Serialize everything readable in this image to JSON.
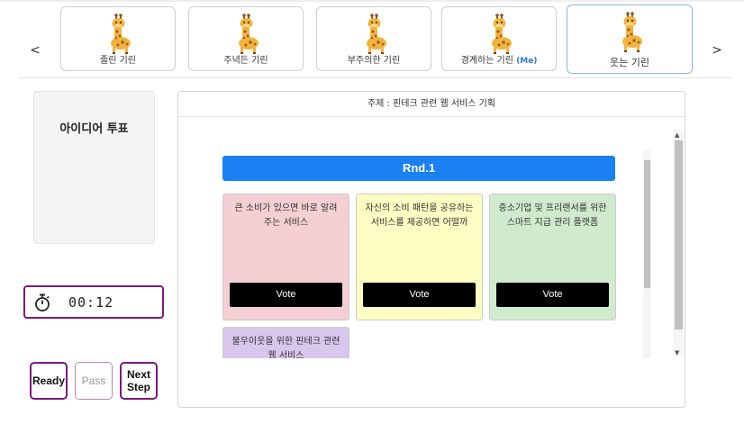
{
  "participants": {
    "prev_arrow": "<",
    "next_arrow": ">",
    "items": [
      {
        "name": "졸린 기린",
        "me_tag": "",
        "active": false
      },
      {
        "name": "주녁든 기린",
        "me_tag": "",
        "active": false
      },
      {
        "name": "부주의한 기린",
        "me_tag": "",
        "active": false
      },
      {
        "name": "경계하는 기린",
        "me_tag": "(Me)",
        "active": false
      },
      {
        "name": "웃는 기린",
        "me_tag": "",
        "active": true
      }
    ]
  },
  "sidebar": {
    "title": "아이디어 투표",
    "timer": "00:12",
    "buttons": {
      "ready": "Ready",
      "pass": "Pass",
      "next_line1": "Next",
      "next_line2": "Step"
    }
  },
  "main": {
    "topic": "주제 : 핀테크 관련 웹 서비스 기획",
    "round": "Rnd.1",
    "vote_label": "Vote",
    "ideas": [
      {
        "text": "큰 소비가 있으면 바로 알려주는 서비스",
        "color": "#f4cfd3"
      },
      {
        "text": "자신의 소비 패턴을 공유하는 서비스를 제공하면 어떨까",
        "color": "#fcfdc3"
      },
      {
        "text": "중소기업 및 프리랜서를 위한 스마트 지급 관리 플랫폼",
        "color": "#cfeacd"
      },
      {
        "text": "불우이웃을 위한 핀테크 관련 웹 서비스",
        "color": "#d9c6ec"
      }
    ]
  },
  "icons": {
    "avatar": "giraffe-icon",
    "timer": "stopwatch-icon"
  },
  "colors": {
    "accent_blue": "#1a80f4",
    "button_border": "#7a1a7a",
    "me_tag": "#2e7be0"
  }
}
